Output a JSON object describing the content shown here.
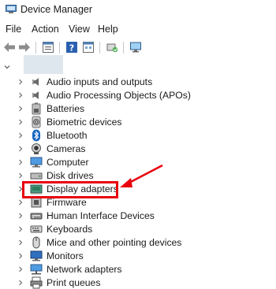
{
  "window": {
    "title": "Device Manager"
  },
  "menu": {
    "items": [
      "File",
      "Action",
      "View",
      "Help"
    ]
  },
  "toolbar": {
    "buttons": [
      {
        "icon": "back-arrow-icon"
      },
      {
        "icon": "forward-arrow-icon"
      },
      {
        "icon": "properties-icon"
      },
      {
        "icon": "help-icon"
      },
      {
        "icon": "show-hidden-icon"
      },
      {
        "icon": "scan-hardware-icon"
      },
      {
        "icon": "monitor-icon"
      }
    ]
  },
  "tree": {
    "items": [
      {
        "label": "Audio inputs and outputs",
        "icon": "speaker-icon"
      },
      {
        "label": "Audio Processing Objects (APOs)",
        "icon": "speaker-icon"
      },
      {
        "label": "Batteries",
        "icon": "battery-icon"
      },
      {
        "label": "Biometric devices",
        "icon": "fingerprint-icon"
      },
      {
        "label": "Bluetooth",
        "icon": "bluetooth-icon"
      },
      {
        "label": "Cameras",
        "icon": "camera-icon"
      },
      {
        "label": "Computer",
        "icon": "computer-icon"
      },
      {
        "label": "Disk drives",
        "icon": "disk-drive-icon"
      },
      {
        "label": "Display adapters",
        "icon": "display-adapter-icon"
      },
      {
        "label": "Firmware",
        "icon": "firmware-icon"
      },
      {
        "label": "Human Interface Devices",
        "icon": "hid-icon"
      },
      {
        "label": "Keyboards",
        "icon": "keyboard-icon"
      },
      {
        "label": "Mice and other pointing devices",
        "icon": "mouse-icon"
      },
      {
        "label": "Monitors",
        "icon": "monitor-icon"
      },
      {
        "label": "Network adapters",
        "icon": "network-adapter-icon"
      },
      {
        "label": "Print queues",
        "icon": "printer-icon"
      }
    ]
  },
  "annotation": {
    "color": "#e8000f",
    "target": "Display adapters"
  }
}
